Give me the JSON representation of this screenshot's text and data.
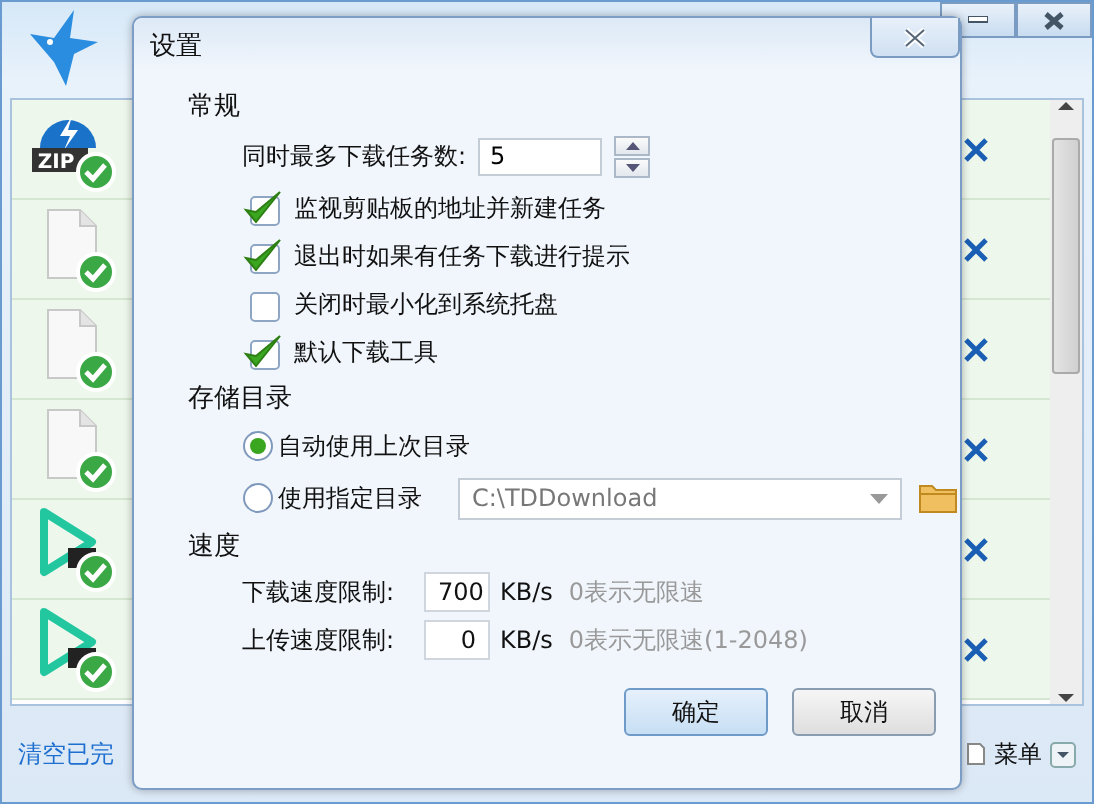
{
  "app": {
    "rows": [
      {
        "kind": "zip",
        "label": "ZIP"
      },
      {
        "kind": "file"
      },
      {
        "kind": "file"
      },
      {
        "kind": "file"
      },
      {
        "kind": "video"
      },
      {
        "kind": "video"
      }
    ],
    "footer": {
      "clear_link": "清空已完",
      "menu": "菜单"
    }
  },
  "dialog": {
    "title": "设置",
    "general": {
      "heading": "常规",
      "max_tasks": {
        "label": "同时最多下载任务数:",
        "value": "5"
      },
      "options": [
        {
          "label": "监视剪贴板的地址并新建任务",
          "checked": true
        },
        {
          "label": "退出时如果有任务下载进行提示",
          "checked": true
        },
        {
          "label": "关闭时最小化到系统托盘",
          "checked": false
        },
        {
          "label": "默认下载工具",
          "checked": true
        }
      ]
    },
    "storage": {
      "heading": "存储目录",
      "choices": [
        {
          "label": "自动使用上次目录",
          "selected": true
        },
        {
          "label": "使用指定目录",
          "selected": false
        }
      ],
      "path": {
        "value": "C:\\TDDownload",
        "disabled": true
      }
    },
    "speed": {
      "heading": "速度",
      "limits": [
        {
          "label": "下载速度限制:",
          "value": "700",
          "unit": "KB/s",
          "hint": "0表示无限速"
        },
        {
          "label": "上传速度限制:",
          "value": "0",
          "unit": "KB/s",
          "hint": "0表示无限速(1-2048)"
        }
      ]
    },
    "buttons": [
      {
        "label": "确定",
        "default": true
      },
      {
        "label": "取消",
        "default": false
      }
    ]
  }
}
